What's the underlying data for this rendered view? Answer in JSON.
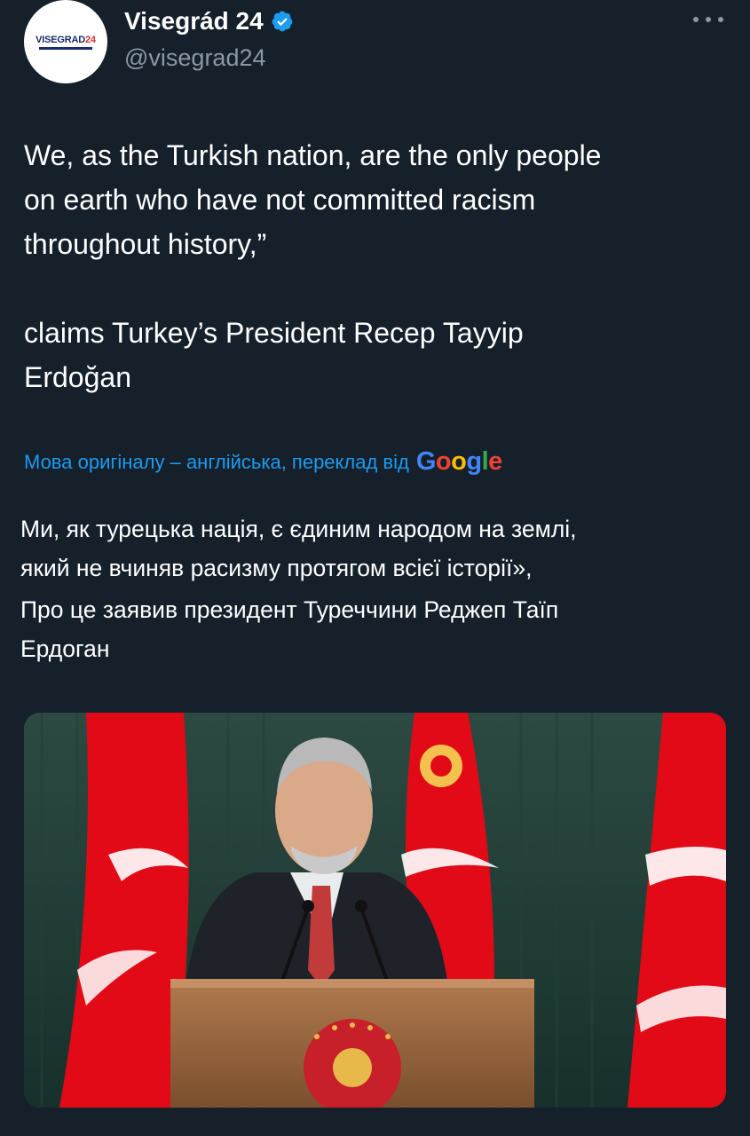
{
  "author": {
    "display_name": "Visegrád 24",
    "handle": "@visegrad24",
    "avatar_text": "VISEGRAD",
    "avatar_text_num": "24"
  },
  "tweet": {
    "paragraphs": [
      "We, as the Turkish nation, are the only people\non earth who have not committed racism\nthroughout history,”",
      "claims Turkey’s President Recep Tayyip\nErdoğan"
    ]
  },
  "translation": {
    "note": "Мова оригіналу – англійська, переклад від",
    "provider": "Google",
    "paragraphs": [
      "Ми, як турецька нація, є єдиним народом на землі,\nякий не вчиняв расизму протягом всієї історії»,",
      "Про це заявив президент Туреччини Реджеп Таїп\nЕрдоган"
    ]
  },
  "icons": {
    "verified": "verified-badge-icon",
    "more": "more-options-icon"
  },
  "colors": {
    "background": "#15202b",
    "link": "#1d9bf0",
    "secondary_text": "#8b98a5",
    "flag_red": "#e30a17"
  }
}
